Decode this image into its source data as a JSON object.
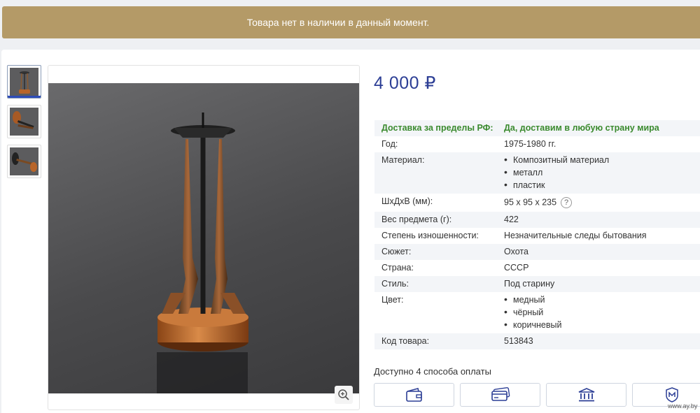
{
  "banner": {
    "text": "Товара нет в наличии в данный момент."
  },
  "price": {
    "value": "4 000 ₽"
  },
  "specs": [
    {
      "key": "Доставка за пределы РФ:",
      "value": "Да, доставим в любую страну мира",
      "green": true
    },
    {
      "key": "Год:",
      "value": "1975-1980 гг."
    },
    {
      "key": "Материал:",
      "list": [
        "Композитный материал",
        "металл",
        "пластик"
      ]
    },
    {
      "key": "ШхДхВ (мм):",
      "value": "95 x 95 x 235",
      "help": "?"
    },
    {
      "key": "Вес предмета (г):",
      "value": "422"
    },
    {
      "key": "Степень изношенности:",
      "value": "Незначительные следы бытования"
    },
    {
      "key": "Сюжет:",
      "value": "Охота"
    },
    {
      "key": "Страна:",
      "value": "СССР"
    },
    {
      "key": "Стиль:",
      "value": "Под старину"
    },
    {
      "key": "Цвет:",
      "list": [
        "медный",
        "чёрный",
        "коричневый"
      ]
    },
    {
      "key": "Код товара:",
      "value": "513843"
    }
  ],
  "payment": {
    "title": "Доступно 4 способа оплаты",
    "methods": [
      "wallet-icon",
      "card-icon",
      "bank-icon",
      "shield-badge-icon"
    ]
  },
  "watermark": "www.ay.by",
  "colors": {
    "banner": "#b49a67",
    "price": "#2c3e95",
    "green": "#3a8a2e"
  }
}
